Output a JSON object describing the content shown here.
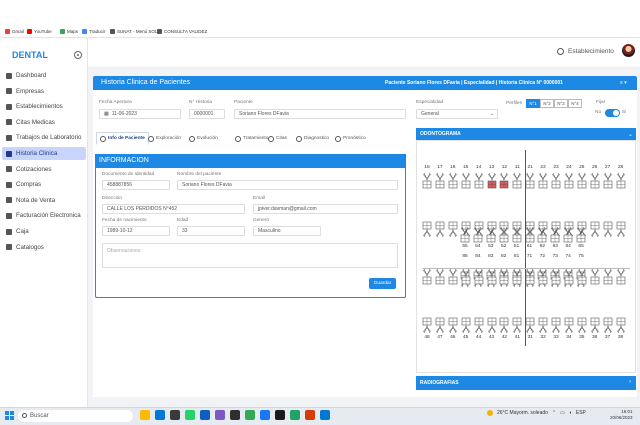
{
  "bookmarks": [
    {
      "label": "Gmail",
      "color": "#ea4335"
    },
    {
      "label": "YouTube",
      "color": "#ff0000"
    },
    {
      "label": "Maps",
      "color": "#34a853"
    },
    {
      "label": "Traducir",
      "color": "#4285f4"
    },
    {
      "label": "SUNAT - Menú SOL",
      "color": "#555"
    },
    {
      "label": "CONSULTA VALIDEZ",
      "color": "#555"
    }
  ],
  "sidebar": {
    "brand": "DENTAL",
    "items": [
      {
        "label": "Dashboard",
        "icon": "home-icon"
      },
      {
        "label": "Empresas",
        "icon": "briefcase-icon"
      },
      {
        "label": "Establecimientos",
        "icon": "building-icon"
      },
      {
        "label": "Citas Medicas",
        "icon": "calendar-icon"
      },
      {
        "label": "Trabajos de Laboratorio",
        "icon": "flask-icon"
      },
      {
        "label": "Historia Clinica",
        "icon": "folder-icon",
        "active": true
      },
      {
        "label": "Cotizaciones",
        "icon": "list-icon"
      },
      {
        "label": "Compras",
        "icon": "cart-icon"
      },
      {
        "label": "Nota de Venta",
        "icon": "tag-icon"
      },
      {
        "label": "Facturación Electronica",
        "icon": "cash-icon"
      },
      {
        "label": "Caja",
        "icon": "dollar-icon"
      },
      {
        "label": "Catalogos",
        "icon": "grid-icon"
      }
    ]
  },
  "topbar": {
    "establecimiento": "Establecimiento"
  },
  "header": {
    "title": "Historia Clinica de Pacientes",
    "info": "Paciente Soriano Flores DFavia  |  Especialidad  |  Historia Clinica N° 0000001",
    "menu_icon": "≡ ▾"
  },
  "form": {
    "fecha_apertura_label": "Fecha Apertura",
    "fecha_apertura": "11-06-2023",
    "nro_historia_label": "N° Historia",
    "nro_historia": "0000001",
    "paciente_label": "Paciente",
    "paciente": "Soriano Flores DFavia",
    "especialidad_label": "Especialidad",
    "especialidad": "General",
    "perfiles_label": "Perfiles",
    "perfiles": [
      "N°1",
      "N°2",
      "N°3",
      "N°4"
    ],
    "fijar_label": "Fijar",
    "fijar_no": "No",
    "fijar_si": "Si"
  },
  "tabs": [
    {
      "label": "Info de Paciente",
      "active": true
    },
    {
      "label": "Exploración"
    },
    {
      "label": "Evolución"
    },
    {
      "label": "Tratamiento"
    },
    {
      "label": "Citas"
    },
    {
      "label": "Diagnostico"
    },
    {
      "label": "Pronóstico"
    }
  ],
  "info": {
    "title": "INFORMACION",
    "doc_label": "Documento de Identidad",
    "doc": "458887856",
    "nombre_label": "Nombre del paciente",
    "nombre": "Soriano Flores DFavia",
    "direccion_label": "Dirección",
    "direccion": "CALLE LOS PERDIDOS N°452",
    "email_label": "Email",
    "email": "jpiver.davman@gmail.com",
    "nac_label": "Fecha de nacimiento",
    "nac": "1989-10-12",
    "edad_label": "Edad",
    "edad": "33",
    "genero_label": "Genero",
    "genero": "Masculino",
    "obs_placeholder": "Observaciones",
    "save": "Guardar"
  },
  "odontograma": {
    "title": "ODONTOGRAMA",
    "row1": [
      "18",
      "17",
      "16",
      "15",
      "14",
      "13",
      "12",
      "11",
      "21",
      "22",
      "23",
      "24",
      "25",
      "26",
      "27",
      "28"
    ],
    "row2": [
      "55",
      "54",
      "53",
      "52",
      "51",
      "61",
      "62",
      "63",
      "64",
      "65"
    ],
    "row3": [
      "85",
      "84",
      "83",
      "82",
      "81",
      "71",
      "72",
      "73",
      "74",
      "75"
    ],
    "row4": [
      "48",
      "47",
      "46",
      "45",
      "44",
      "43",
      "42",
      "41",
      "31",
      "32",
      "33",
      "34",
      "35",
      "36",
      "37",
      "38"
    ],
    "marked": [
      "13",
      "12"
    ],
    "mark_color": "#e35757"
  },
  "radiografias": {
    "title": "RADIOGRAFIAS"
  },
  "taskbar": {
    "search": "Buscar",
    "weather": "26°C  Mayorm. soleado",
    "lang": "ESP",
    "time": "16:01",
    "date": "20/06/2023"
  }
}
